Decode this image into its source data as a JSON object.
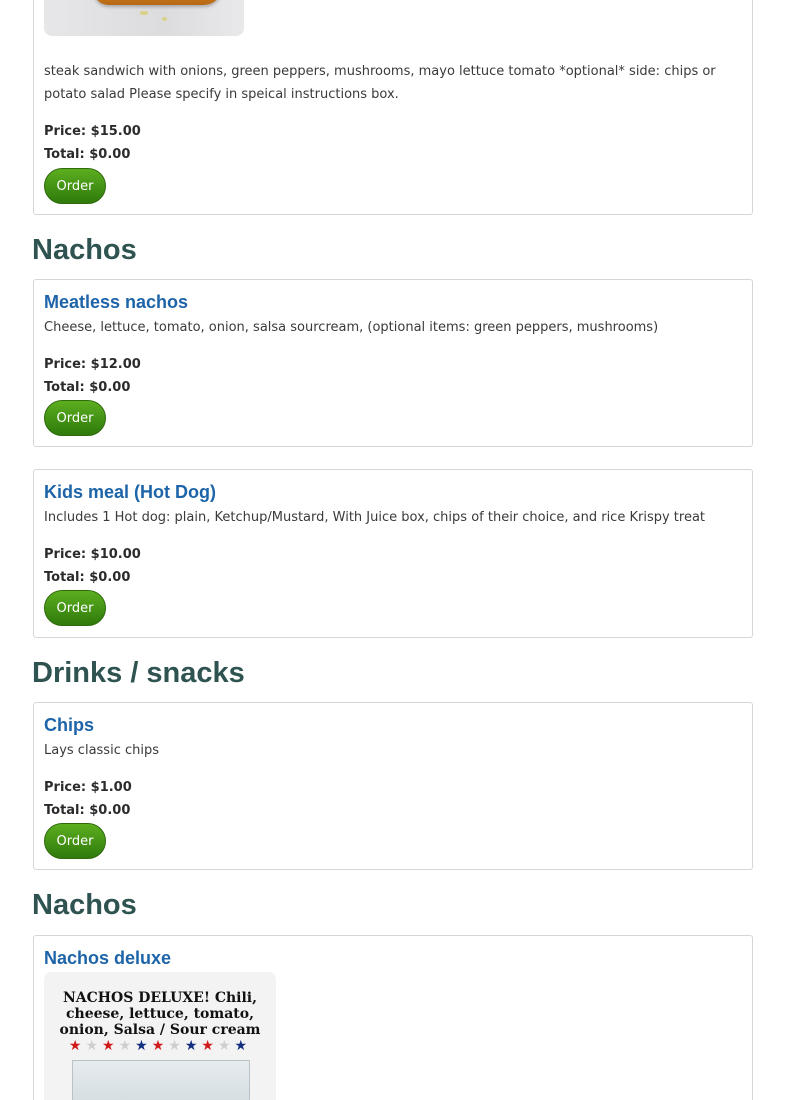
{
  "top_item": {
    "description": "steak sandwich with onions, green peppers, mushrooms, mayo lettuce tomato *optional* side: chips or potato salad Please specify in speical instructions box.",
    "price": "Price: $15.00",
    "total": "Total: $0.00",
    "order_label": "Order"
  },
  "sections": [
    {
      "heading": "Nachos",
      "items": [
        {
          "name": "Meatless nachos",
          "description": "Cheese, lettuce, tomato, onion, salsa sourcream, (optional items: green peppers, mushrooms)",
          "price": "Price: $12.00",
          "total": "Total: $0.00",
          "order_label": "Order"
        },
        {
          "name": "Kids meal (Hot Dog)",
          "description": "Includes 1 Hot dog: plain, Ketchup/Mustard, With Juice box, chips of their choice, and rice Krispy treat",
          "price": "Price: $10.00",
          "total": "Total: $0.00",
          "order_label": "Order"
        }
      ]
    },
    {
      "heading": "Drinks / snacks",
      "items": [
        {
          "name": "Chips",
          "description": "Lays classic chips",
          "price": "Price: $1.00",
          "total": "Total: $0.00",
          "order_label": "Order"
        }
      ]
    },
    {
      "heading": "Nachos",
      "items": [
        {
          "name": "Nachos deluxe",
          "image_text": "NACHOS DELUXE! Chili, cheese, lettuce, tomato, onion, Salsa / Sour cream"
        }
      ]
    }
  ],
  "colors": {
    "item_title": "#1d64a8",
    "section_heading": "#2e5350",
    "order_button": "#4a9a18"
  }
}
